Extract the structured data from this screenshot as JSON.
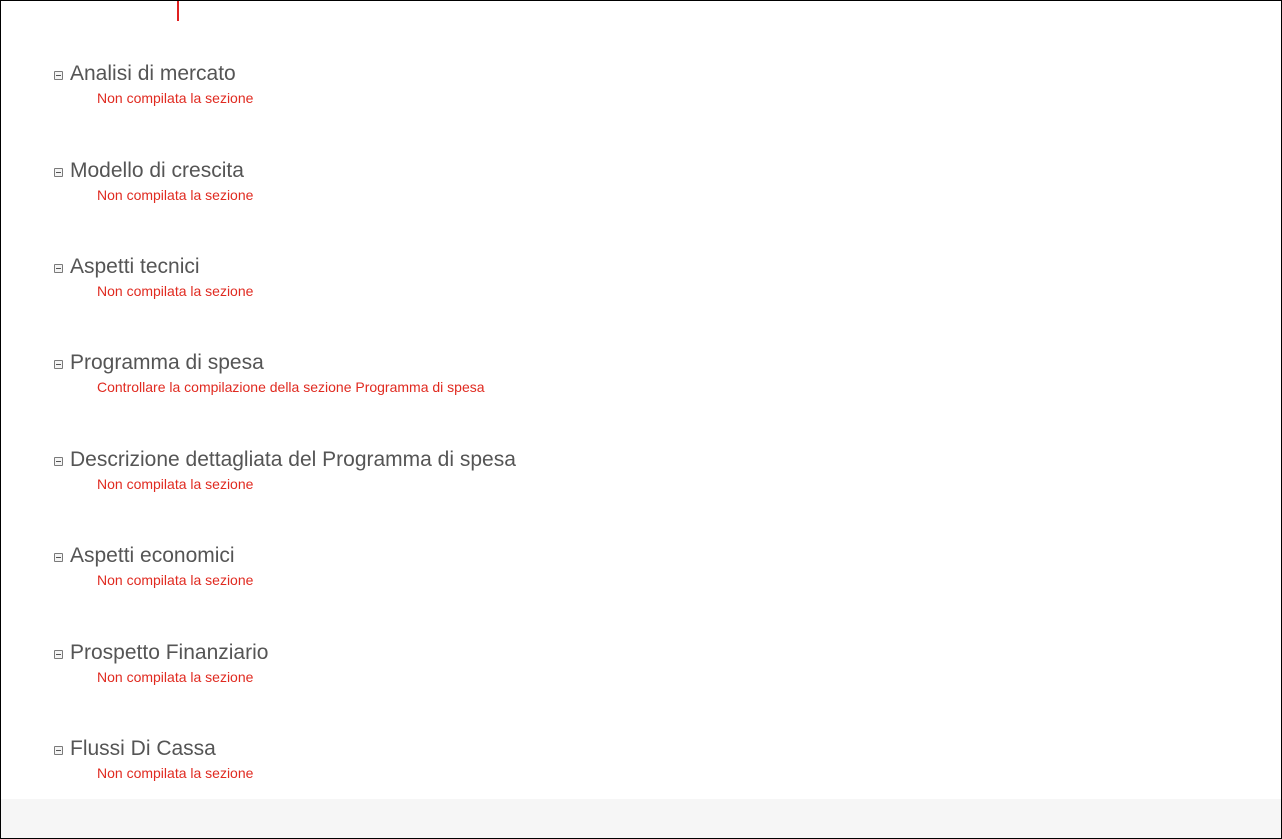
{
  "sections": [
    {
      "title": "Analisi di mercato",
      "message": "Non compilata la sezione"
    },
    {
      "title": "Modello di crescita",
      "message": "Non compilata la sezione"
    },
    {
      "title": "Aspetti tecnici",
      "message": "Non compilata la sezione"
    },
    {
      "title": "Programma di spesa",
      "message": "Controllare la compilazione della sezione Programma di spesa"
    },
    {
      "title": "Descrizione dettagliata del Programma di spesa",
      "message": "Non compilata la sezione"
    },
    {
      "title": "Aspetti economici",
      "message": "Non compilata la sezione"
    },
    {
      "title": "Prospetto Finanziario",
      "message": "Non compilata la sezione"
    },
    {
      "title": "Flussi Di Cassa",
      "message": "Non compilata la sezione"
    }
  ],
  "colors": {
    "title": "#555555",
    "error": "#e02a20",
    "footer": "#f6f6f6"
  },
  "icons": {
    "collapse": "collapse-minus-icon"
  }
}
